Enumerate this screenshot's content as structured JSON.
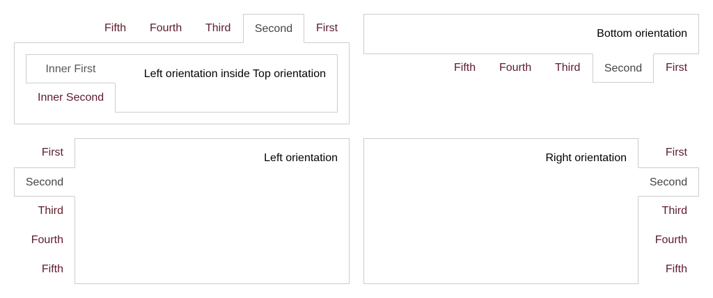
{
  "top_panel": {
    "tabs": [
      "Fifth",
      "Fourth",
      "Third",
      "Second",
      "First"
    ],
    "active_tab": "Second",
    "inner": {
      "tabs": [
        "Inner First",
        "Inner Second"
      ],
      "active_tab": "Inner First",
      "content": "Left orientation inside Top orientation"
    }
  },
  "bottom_panel": {
    "content": "Bottom orientation",
    "tabs": [
      "Fifth",
      "Fourth",
      "Third",
      "Second",
      "First"
    ],
    "active_tab": "Second"
  },
  "left_panel": {
    "content": "Left orientation",
    "tabs": [
      "First",
      "Second",
      "Third",
      "Fourth",
      "Fifth"
    ],
    "active_tab": "Second"
  },
  "right_panel": {
    "content": "Right orientation",
    "tabs": [
      "First",
      "Second",
      "Third",
      "Fourth",
      "Fifth"
    ],
    "active_tab": "Second"
  },
  "colors": {
    "tab_text": "#5b1a2a",
    "active_tab_text": "#444444",
    "border": "#cccccc"
  }
}
